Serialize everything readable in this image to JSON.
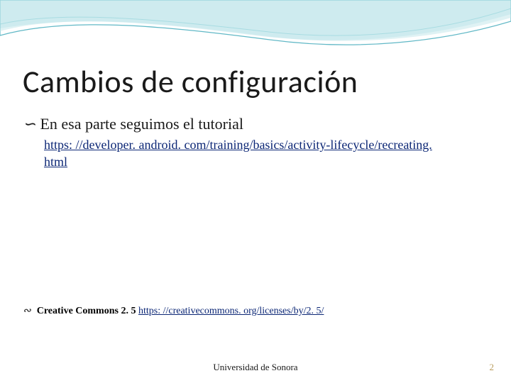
{
  "slide": {
    "title": "Cambios de configuración",
    "bullet1": {
      "glyph": "∽",
      "text": "En esa parte seguimos el tutorial",
      "link_text": "https: //developer. android. com/training/basics/activity-lifecycle/recreating. html"
    },
    "cc": {
      "glyph": "∾",
      "label": "Creative Commons 2. 5 ",
      "link_text": "https: //creativecommons. org/licenses/by/2. 5/"
    },
    "footer": "Universidad de Sonora",
    "page": "2"
  }
}
